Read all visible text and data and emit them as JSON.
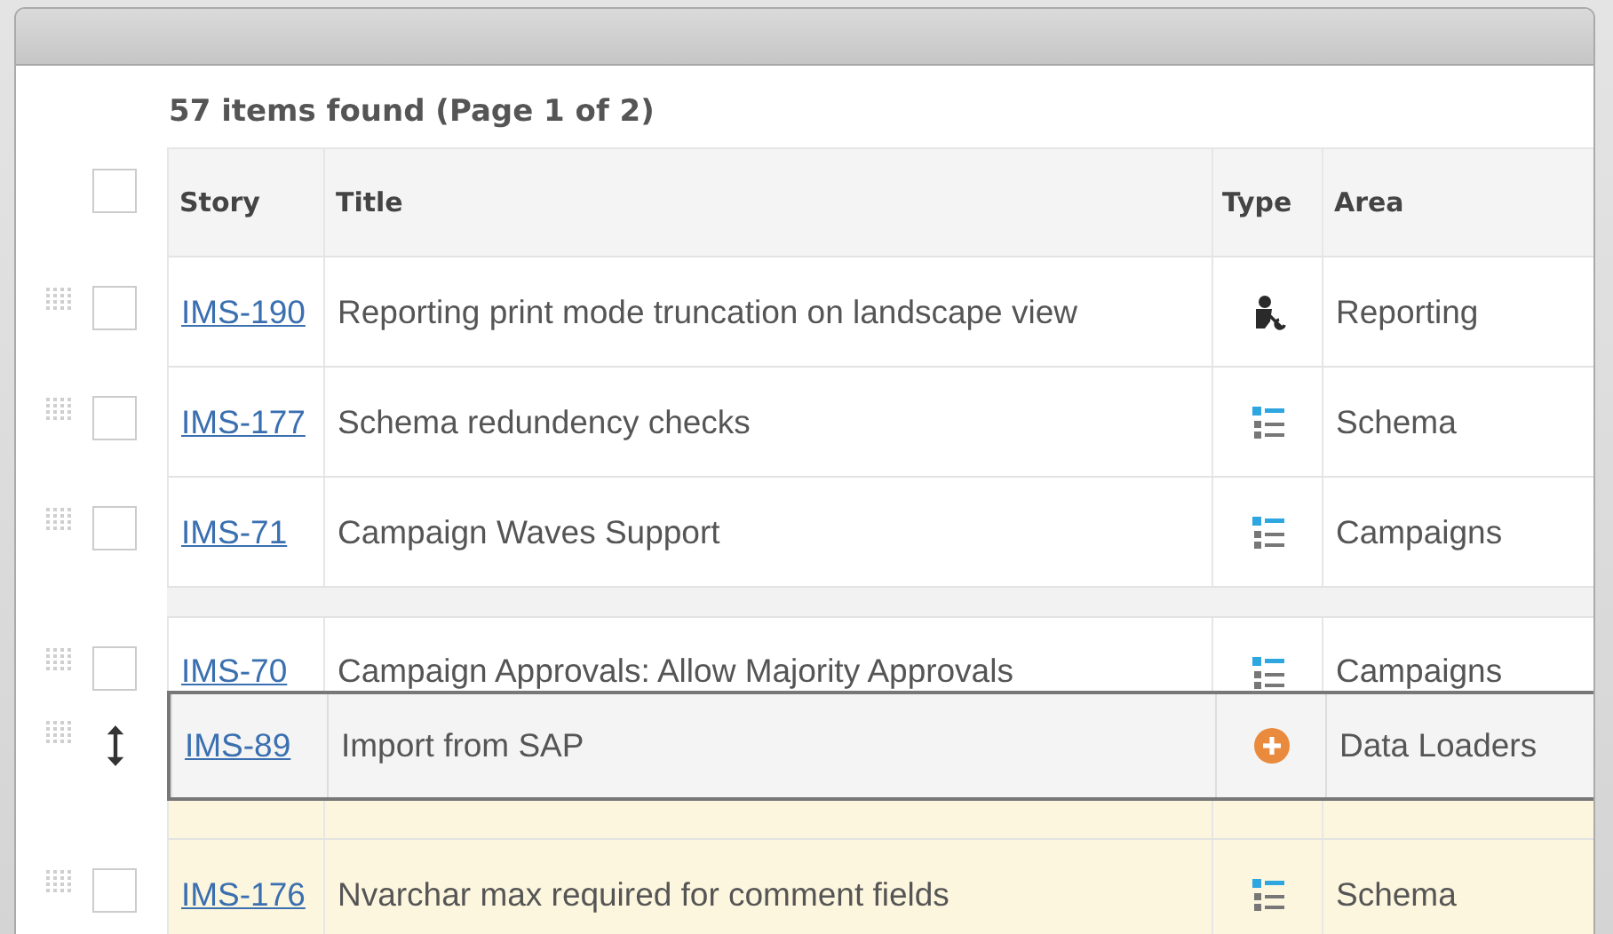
{
  "caption": "57 items found (Page 1 of 2)",
  "select_all": {
    "checked": false
  },
  "columns": [
    "Story",
    "Title",
    "Type",
    "Area"
  ],
  "rows": [
    {
      "kind": "item",
      "story": "IMS-190",
      "title": "Reporting print mode truncation on landscape view",
      "type": {
        "kind": "defect"
      },
      "area": "Reporting",
      "checked": false,
      "highlighted": false
    },
    {
      "kind": "item",
      "story": "IMS-177",
      "title": "Schema redundency checks",
      "type": {
        "kind": "story"
      },
      "area": "Schema",
      "checked": false,
      "highlighted": false
    },
    {
      "kind": "item",
      "story": "IMS-71",
      "title": "Campaign Waves Support",
      "type": {
        "kind": "story"
      },
      "area": "Campaigns",
      "checked": false,
      "highlighted": false
    },
    {
      "kind": "drop-gap"
    },
    {
      "kind": "item",
      "story": "IMS-70",
      "title": "Campaign Approvals: Allow Majority Approvals",
      "type": {
        "kind": "story"
      },
      "area": "Campaigns",
      "checked": false,
      "highlighted": false
    },
    {
      "kind": "dragged",
      "story": "IMS-89",
      "title": "Import from SAP",
      "type": {
        "kind": "feature"
      },
      "area": "Data Loaders"
    },
    {
      "kind": "covered",
      "highlighted": true
    },
    {
      "kind": "item",
      "story": "IMS-176",
      "title": "Nvarchar max required for comment fields",
      "type": {
        "kind": "story"
      },
      "area": "Schema",
      "checked": false,
      "highlighted": true
    }
  ]
}
